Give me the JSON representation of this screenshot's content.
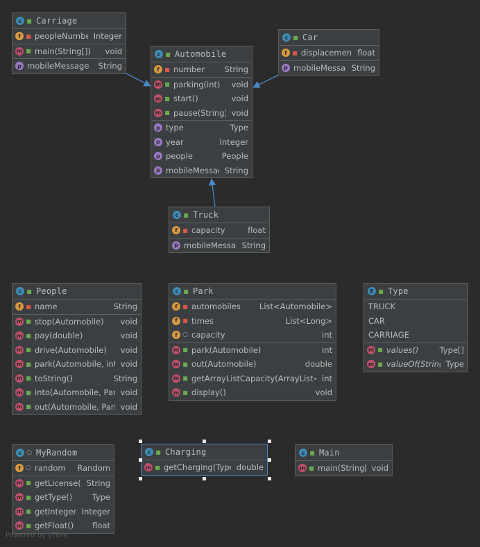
{
  "footer": "Powered by yFiles",
  "colors": {
    "background": "#2b2b2b",
    "node": "#3c3f41",
    "edge": "#4a88c7",
    "class_icon": "#3d8bb5",
    "field_icon": "#d99a3f",
    "method_icon": "#c0506a",
    "property_icon": "#9b78c7"
  },
  "classes": {
    "carriage": {
      "name": "Carriage",
      "fields": [
        {
          "name": "peopleNumber",
          "type": "Integer"
        }
      ],
      "methods": [
        {
          "name": "main(String[])",
          "type": "void"
        }
      ],
      "properties": [
        {
          "name": "mobileMessage",
          "type": "String"
        }
      ]
    },
    "automobile": {
      "name": "Automobile",
      "fields": [
        {
          "name": "number",
          "type": "String"
        }
      ],
      "methods": [
        {
          "name": "parking(int)",
          "type": "void"
        },
        {
          "name": "start()",
          "type": "void"
        },
        {
          "name": "pause(String)",
          "type": "void"
        }
      ],
      "properties": [
        {
          "name": "type",
          "type": "Type"
        },
        {
          "name": "year",
          "type": "Integer"
        },
        {
          "name": "people",
          "type": "People"
        },
        {
          "name": "mobileMessage",
          "type": "String"
        }
      ]
    },
    "car": {
      "name": "Car",
      "fields": [
        {
          "name": "displacement",
          "type": "float"
        }
      ],
      "properties": [
        {
          "name": "mobileMessage",
          "type": "String"
        }
      ]
    },
    "truck": {
      "name": "Truck",
      "fields": [
        {
          "name": "capacity",
          "type": "float"
        }
      ],
      "properties": [
        {
          "name": "mobileMessage",
          "type": "String"
        }
      ]
    },
    "people": {
      "name": "People",
      "fields": [
        {
          "name": "name",
          "type": "String"
        }
      ],
      "methods": [
        {
          "name": "stop(Automobile)",
          "type": "void"
        },
        {
          "name": "pay(double)",
          "type": "void"
        },
        {
          "name": "drive(Automobile)",
          "type": "void"
        },
        {
          "name": "park(Automobile, int)",
          "type": "void"
        },
        {
          "name": "toString()",
          "type": "String"
        },
        {
          "name": "into(Automobile, Park)",
          "type": "void"
        },
        {
          "name": "out(Automobile, Park)",
          "type": "void"
        }
      ]
    },
    "park": {
      "name": "Park",
      "fields": [
        {
          "name": "automobiles",
          "type": "List<Automobile>"
        },
        {
          "name": "times",
          "type": "List<Long>"
        },
        {
          "name": "capacity",
          "type": "int"
        }
      ],
      "methods": [
        {
          "name": "park(Automobile)",
          "type": "int"
        },
        {
          "name": "out(Automobile)",
          "type": "double"
        },
        {
          "name": "getArrayListCapacity(ArrayList<?>)",
          "type": "int"
        },
        {
          "name": "display()",
          "type": "void"
        }
      ]
    },
    "type": {
      "name": "Type",
      "constants": [
        "TRUCK",
        "CAR",
        "CARRIAGE"
      ],
      "methods": [
        {
          "name": "values()",
          "type": "Type[]"
        },
        {
          "name": "valueOf(String)",
          "type": "Type"
        }
      ]
    },
    "myrandom": {
      "name": "MyRandom",
      "fields": [
        {
          "name": "random",
          "type": "Random"
        }
      ],
      "methods": [
        {
          "name": "getLicense()",
          "type": "String"
        },
        {
          "name": "getType()",
          "type": "Type"
        },
        {
          "name": "getInteger()",
          "type": "Integer"
        },
        {
          "name": "getFloat()",
          "type": "float"
        }
      ]
    },
    "charging": {
      "name": "Charging",
      "methods": [
        {
          "name": "getCharging(Type)",
          "type": "double"
        }
      ]
    },
    "main": {
      "name": "Main",
      "methods": [
        {
          "name": "main(String[])",
          "type": "void"
        }
      ]
    }
  }
}
